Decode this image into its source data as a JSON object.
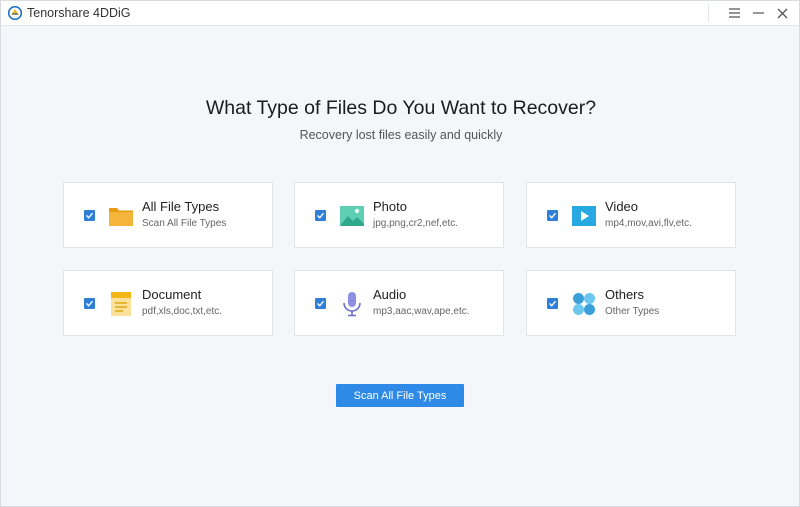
{
  "titlebar": {
    "app_title": "Tenorshare 4DDiG",
    "menu_icon": "menu-icon",
    "minimize_icon": "minimize-icon",
    "close_icon": "close-icon"
  },
  "main": {
    "heading": "What Type of Files Do You Want to Recover?",
    "subheading": "Recovery lost files easily and quickly"
  },
  "file_types": [
    {
      "title": "All File Types",
      "description": "Scan All File Types",
      "icon": "folder-icon",
      "checked": true
    },
    {
      "title": "Photo",
      "description": "jpg,png,cr2,nef,etc.",
      "icon": "photo-icon",
      "checked": true
    },
    {
      "title": "Video",
      "description": "mp4,mov,avi,flv,etc.",
      "icon": "video-icon",
      "checked": true
    },
    {
      "title": "Document",
      "description": "pdf,xls,doc,txt,etc.",
      "icon": "document-icon",
      "checked": true
    },
    {
      "title": "Audio",
      "description": "mp3,aac,wav,ape,etc.",
      "icon": "microphone-icon",
      "checked": true
    },
    {
      "title": "Others",
      "description": "Other Types",
      "icon": "others-icon",
      "checked": true
    }
  ],
  "scan_button": {
    "label": "Scan All File Types"
  },
  "colors": {
    "accent": "#2e8ae6",
    "checkbox": "#2f7fd6",
    "folder": "#f5a623",
    "photo": "#4cc3a6",
    "video": "#29a9e1",
    "document": "#f7c948",
    "audio": "#7a7fd6",
    "others": "#4aa9dc"
  }
}
